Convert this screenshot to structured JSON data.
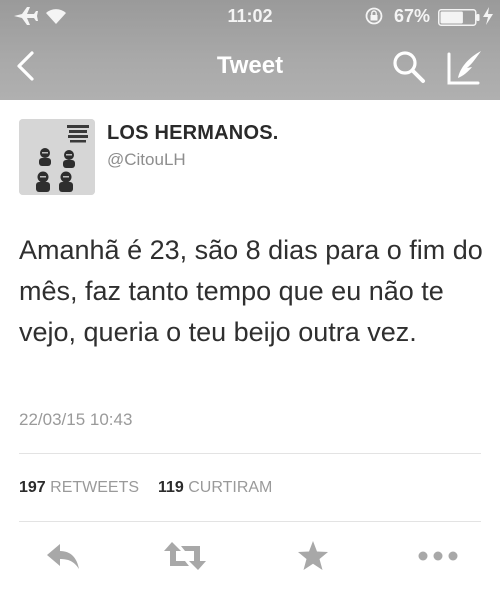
{
  "status_bar": {
    "time": "11:02",
    "battery_percent": "67%",
    "battery_level": 0.67
  },
  "nav": {
    "title": "Tweet"
  },
  "tweet": {
    "author_name": "LOS HERMANOS.",
    "author_handle": "@CitouLH",
    "text": "Amanhã é 23, são 8 dias para o fim do mês, faz tanto tempo que eu não te vejo, queria o teu beijo outra vez.",
    "timestamp": "22/03/15 10:43"
  },
  "stats": {
    "retweets_count": "197",
    "retweets_label": "RETWEETS",
    "likes_count": "119",
    "likes_label": "CURTIRAM"
  },
  "colors": {
    "top_bar": "#a5a5a5",
    "text": "#2b2b2b",
    "muted": "#9a9a9a",
    "action_icon": "#a8a8a8"
  },
  "icons": [
    "airplane-icon",
    "wifi-icon",
    "orientation-lock-icon",
    "battery-icon",
    "charging-icon",
    "back-chevron-icon",
    "search-icon",
    "compose-icon",
    "reply-icon",
    "retweet-icon",
    "favorite-star-icon",
    "more-icon"
  ]
}
